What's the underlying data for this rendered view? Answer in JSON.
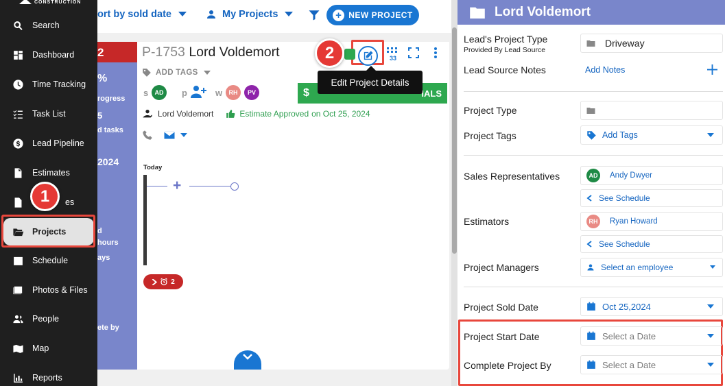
{
  "sidebar": {
    "brand": "CONSTRUCTION",
    "items": [
      {
        "label": "Search",
        "icon": "search-icon"
      },
      {
        "label": "Dashboard",
        "icon": "dashboard-icon"
      },
      {
        "label": "Time Tracking",
        "icon": "clock-icon"
      },
      {
        "label": "Task List",
        "icon": "checklist-icon"
      },
      {
        "label": "Lead Pipeline",
        "icon": "dollar-icon"
      },
      {
        "label": "Estimates",
        "icon": "document-icon"
      },
      {
        "label": "Invoices",
        "icon": "invoice-icon",
        "visible_text": "es"
      },
      {
        "label": "Projects",
        "icon": "folder-open-icon",
        "active": true
      },
      {
        "label": "Schedule",
        "icon": "calendar-icon"
      },
      {
        "label": "Photos & Files",
        "icon": "photos-icon"
      },
      {
        "label": "People",
        "icon": "people-icon"
      },
      {
        "label": "Map",
        "icon": "map-icon"
      },
      {
        "label": "Reports",
        "icon": "reports-icon"
      }
    ]
  },
  "topbar": {
    "sort_label": "ort by sold date",
    "my_projects_label": "My Projects",
    "new_project_label": "NEW PROJECT"
  },
  "prev_card": {
    "count": "2",
    "percent": "%",
    "progress": "rogress",
    "tasks_num": "5",
    "tasks": "d tasks",
    "year": "2024",
    "d": "d",
    "hours": "hours",
    "days": "ays",
    "complete_by": "ete by"
  },
  "card": {
    "project_id": "P-1753",
    "project_name": "Lord Voldemort",
    "add_tags": "ADD TAGS",
    "role_s": "s",
    "role_p": "p",
    "role_w": "w",
    "avatars": {
      "ad": "AD",
      "rh": "RH",
      "pv": "PV"
    },
    "client": "Lord Voldemort",
    "estimate_status": "Estimate Approved",
    "estimate_date": "on Oct 25, 2024",
    "details_label": "IALS",
    "grid_count": "33",
    "today_label": "Today",
    "alarm_count": "2"
  },
  "tooltip": {
    "text": "Edit Project Details"
  },
  "badges": {
    "one": "1",
    "two": "2"
  },
  "panel": {
    "title": "Lord Voldemort",
    "lead_type_label": "Lead's Project Type",
    "lead_type_sub": "Provided By Lead Source",
    "lead_type_value": "Driveway",
    "lead_notes_label": "Lead Source Notes",
    "add_notes": "Add Notes",
    "project_type_label": "Project Type",
    "project_tags_label": "Project Tags",
    "add_tags": "Add Tags",
    "sales_reps_label": "Sales Representatives",
    "sales_rep_initials": "AD",
    "sales_rep_name": "Andy Dwyer",
    "see_schedule": "See Schedule",
    "estimators_label": "Estimators",
    "estimator_initials": "RH",
    "estimator_name": "Ryan Howard",
    "managers_label": "Project Managers",
    "select_employee": "Select an employee",
    "sold_date_label": "Project Sold Date",
    "sold_date_value": "Oct 25,2024",
    "start_date_label": "Project Start Date",
    "complete_by_label": "Complete Project By",
    "select_date": "Select a Date"
  },
  "colors": {
    "accent": "#1976d2",
    "panel_header": "#7986cb",
    "highlight": "#e8473c",
    "success": "#2ea84f",
    "sidebar": "#1f1f1f"
  }
}
